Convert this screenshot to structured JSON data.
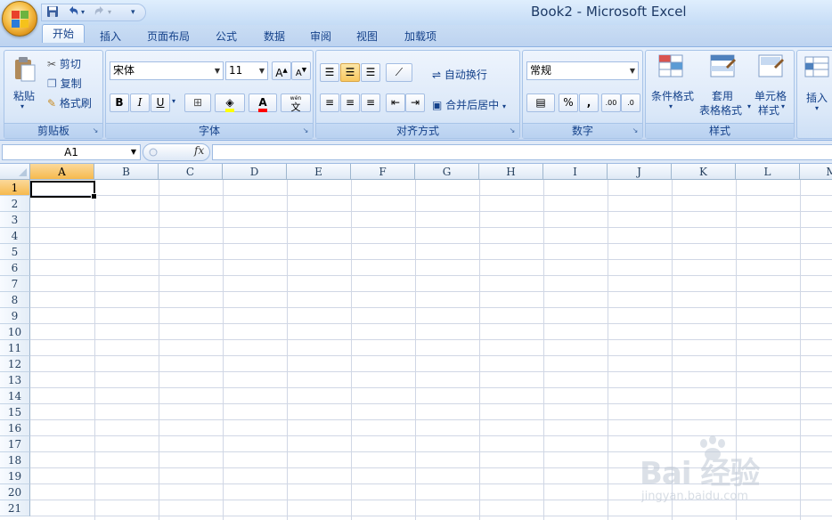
{
  "window": {
    "title": "Book2 - Microsoft Excel"
  },
  "qat": {
    "save_icon": "save-icon",
    "undo_icon": "undo-icon",
    "redo_icon": "redo-icon",
    "customize_icon": "customize-icon"
  },
  "tabs": [
    "开始",
    "插入",
    "页面布局",
    "公式",
    "数据",
    "审阅",
    "视图",
    "加载项"
  ],
  "ribbon": {
    "clipboard": {
      "label": "剪贴板",
      "paste": "粘贴",
      "cut": "剪切",
      "copy": "复制",
      "format_painter": "格式刷"
    },
    "font": {
      "label": "字体",
      "font_name": "宋体",
      "font_size": "11",
      "bold": "B",
      "italic": "I",
      "underline": "U",
      "font_color_letter": "A",
      "phonetic_top": "wén",
      "phonetic_char": "文"
    },
    "alignment": {
      "label": "对齐方式",
      "wrap_text": "自动换行",
      "merge_center": "合并后居中"
    },
    "number": {
      "label": "数字",
      "format": "常规",
      "percent": "%",
      "comma": ",",
      "inc_decimal": ".00",
      "dec_decimal": ".0"
    },
    "styles": {
      "label": "样式",
      "conditional": "条件格式",
      "table_format_1": "套用",
      "table_format_2": "表格格式",
      "cell_styles_1": "单元格",
      "cell_styles_2": "样式"
    },
    "cells": {
      "insert": "插入"
    }
  },
  "formula_bar": {
    "name_box": "A1",
    "fx": "fx",
    "value": ""
  },
  "sheet": {
    "columns": [
      "A",
      "B",
      "C",
      "D",
      "E",
      "F",
      "G",
      "H",
      "I",
      "J",
      "K",
      "L",
      "M"
    ],
    "rows": [
      "1",
      "2",
      "3",
      "4",
      "5",
      "6",
      "7",
      "8",
      "9",
      "10",
      "11",
      "12",
      "13",
      "14",
      "15",
      "16",
      "17",
      "18",
      "19",
      "20",
      "21"
    ],
    "active_cell": "A1"
  },
  "watermark": {
    "logo": "Bai 经验",
    "url": "jingyan.baidu.com"
  },
  "colors": {
    "ribbon_bg": "#dbe8f8",
    "accent": "#15428b",
    "selection": "#f6b94e"
  }
}
